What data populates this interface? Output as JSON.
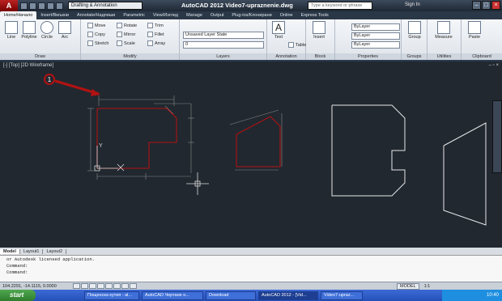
{
  "app": {
    "title": "AutoCAD 2012   Video7-upraznenie.dwg",
    "workspace": "Drafting & Annotation",
    "search_placeholder": "Type a keyword or phrase",
    "signin": "Sign In"
  },
  "tabs": [
    "Home/Начало",
    "Insert/Вмъкни",
    "Annotate/Надпиши",
    "Parametric",
    "View/Изглед",
    "Manage",
    "Output",
    "Plug-ins/Клонирани",
    "Online",
    "Express Tools"
  ],
  "ribbon": {
    "draw": {
      "title": "Draw",
      "line": "Line",
      "polyline": "Polyline",
      "circle": "Circle",
      "arc": "Arc"
    },
    "modify": {
      "title": "Modify",
      "move": "Move",
      "rotate": "Rotate",
      "trim": "Trim",
      "copy": "Copy",
      "mirror": "Mirror",
      "fillet": "Fillet",
      "stretch": "Stretch",
      "scale": "Scale",
      "array": "Array"
    },
    "layers": {
      "title": "Layers",
      "state": "Unsaved Layer State",
      "current": "0"
    },
    "annotation": {
      "title": "Annotation",
      "text": "Text",
      "table": "Table"
    },
    "block": {
      "title": "Block",
      "insert": "Insert"
    },
    "properties": {
      "title": "Properties",
      "color": "ByLayer",
      "linetype": "ByLayer",
      "lineweight": "ByLayer"
    },
    "groups": {
      "title": "Groups",
      "group": "Group"
    },
    "utilities": {
      "title": "Utilities",
      "measure": "Measure"
    },
    "clipboard": {
      "title": "Clipboard",
      "paste": "Paste"
    }
  },
  "viewport": {
    "label": "[-] [Top] [2D Wireframe]"
  },
  "callout": {
    "number": "1"
  },
  "layout_tabs": [
    "Model",
    "Layout1",
    "Layout2"
  ],
  "command": {
    "lines": [
      "or Autodesk licensed application.",
      "Command:",
      "",
      "Command:"
    ]
  },
  "status": {
    "coords": "104.2291, -14.1115, 0.0000",
    "model": "MODEL",
    "scale": "1:1"
  },
  "taskbar": {
    "start": "start",
    "items": [
      "Пощенска кутия - al...",
      "AutoCAD Чертане н...",
      "Download",
      "AutoCAD 2012 - [Vid...",
      "Video7-upraz..."
    ],
    "clock": "10:40"
  },
  "colors": {
    "accent_red": "#b21212",
    "canvas_bg": "#212830"
  }
}
